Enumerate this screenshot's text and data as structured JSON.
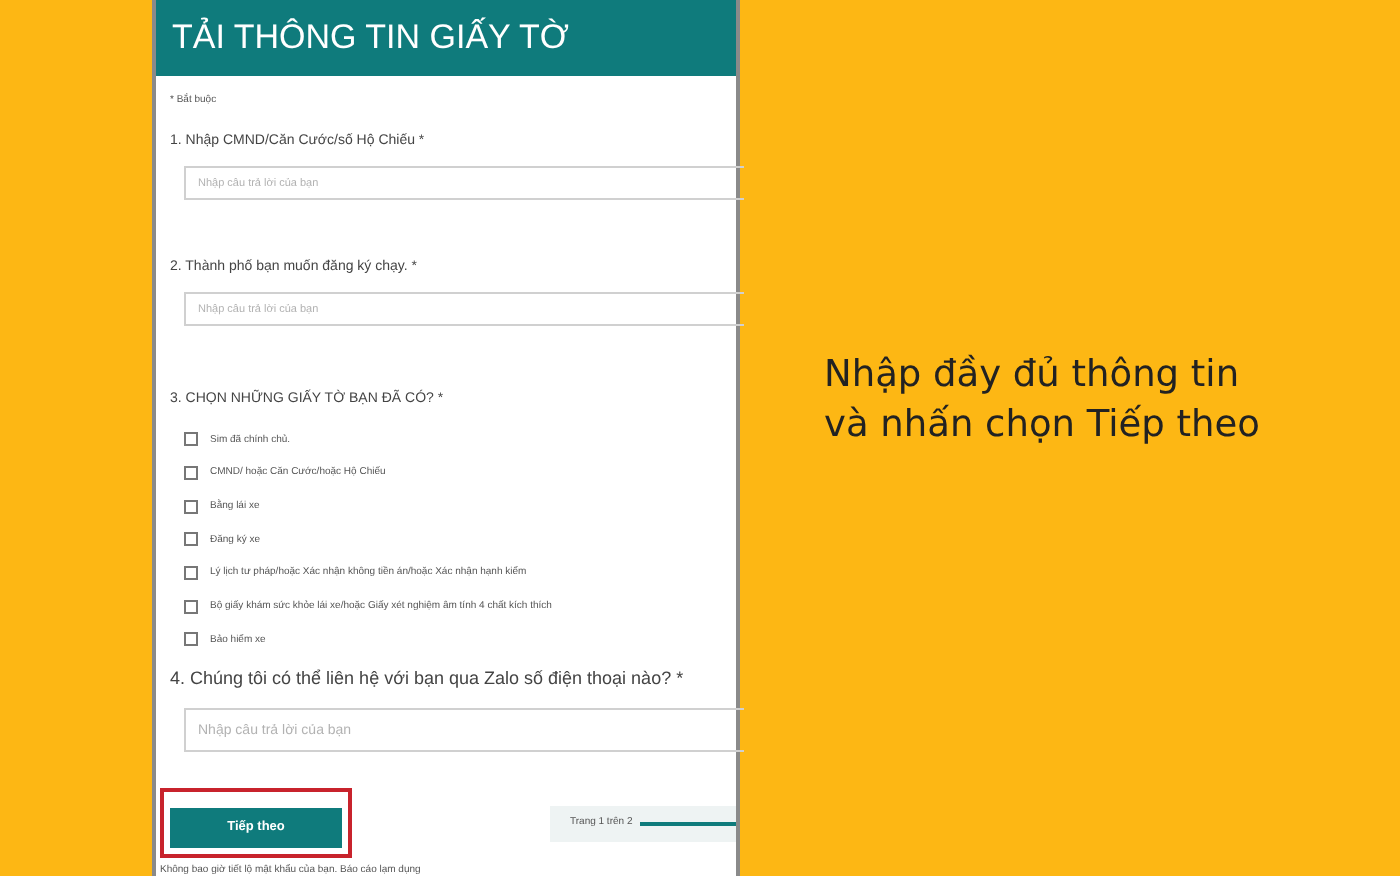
{
  "form": {
    "title": "TẢI THÔNG TIN GIẤY TỜ",
    "required_note": "* Bắt buộc",
    "questions": [
      {
        "kind": "text",
        "label": "1. Nhập CMND/Căn Cước/số Hộ Chiếu *",
        "placeholder": "Nhập câu trả lời của bạn"
      },
      {
        "kind": "text",
        "label": "2. Thành phố bạn muốn đăng ký chạy. *",
        "placeholder": "Nhập câu trả lời của bạn"
      },
      {
        "kind": "checkboxes",
        "label": "3. CHỌN NHỮNG GIẤY TỜ BẠN ĐÃ CÓ? *",
        "options": [
          {
            "label": "Sim đã chính chủ.",
            "checked": false
          },
          {
            "label": "CMND/ hoặc Căn Cước/hoặc Hộ Chiếu",
            "checked": false
          },
          {
            "label": "Bằng lái xe",
            "checked": false
          },
          {
            "label": "Đăng ký xe",
            "checked": false
          },
          {
            "label": "Lý lịch tư pháp/hoặc Xác nhận không tiền án/hoặc Xác nhận hạnh kiểm",
            "checked": false
          },
          {
            "label": "Bộ giấy khám sức khỏe lái xe/hoặc Giấy xét nghiệm âm tính 4 chất kích thích",
            "checked": false
          },
          {
            "label": "Bảo hiểm xe",
            "checked": false
          }
        ]
      },
      {
        "kind": "text",
        "label": "4. Chúng tôi có thể liên hệ với bạn qua Zalo số điện thoại nào? *",
        "placeholder": "Nhập câu trả lời của bạn"
      }
    ],
    "next_button": "Tiếp theo",
    "page_indicator": "Trang 1 trên 2",
    "footer": "Không bao giờ tiết lộ mật khẩu của bạn. Báo cáo lạm dụng"
  },
  "caption_lines": [
    "Nhập đầy đủ thông tin",
    "và nhấn chọn Tiếp theo"
  ]
}
